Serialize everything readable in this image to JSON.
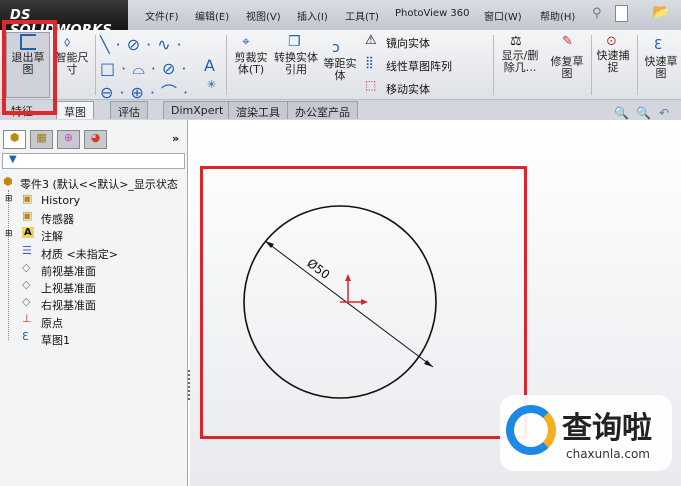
{
  "app": {
    "logo": "DS SOLIDWORKS"
  },
  "menu": [
    "文件(F)",
    "编辑(E)",
    "视图(V)",
    "插入(I)",
    "工具(T)",
    "PhotoView 360",
    "窗口(W)",
    "帮助(H)"
  ],
  "ribbon": {
    "exit_sketch": "退出草图",
    "smart_dim": "智能尺寸",
    "trim": "剪裁实体(T)",
    "convert": "转换实体引用",
    "offset": "等距实体",
    "mirror": "镜向实体",
    "linear_pattern": "线性草图阵列",
    "move": "移动实体",
    "show_delete": "显示/删除几...",
    "repair": "修复草图",
    "quick_snap": "快速捕捉",
    "rapid_sketch": "快速草图"
  },
  "tabs": [
    "特征",
    "草图",
    "评估",
    "DimXpert",
    "渲染工具",
    "办公室产品"
  ],
  "tree": {
    "root": "零件3 (默认<<默认>_显示状态",
    "items": [
      "History",
      "传感器",
      "注解",
      "材质 <未指定>",
      "前视基准面",
      "上视基准面",
      "右视基准面",
      "原点",
      "草图1"
    ]
  },
  "dimension": "Ø50",
  "watermark": {
    "name": "查询啦",
    "url": "chaxunla.com"
  },
  "colors": {
    "highlight": "#d9262b",
    "watermark": "#1e88e5"
  }
}
